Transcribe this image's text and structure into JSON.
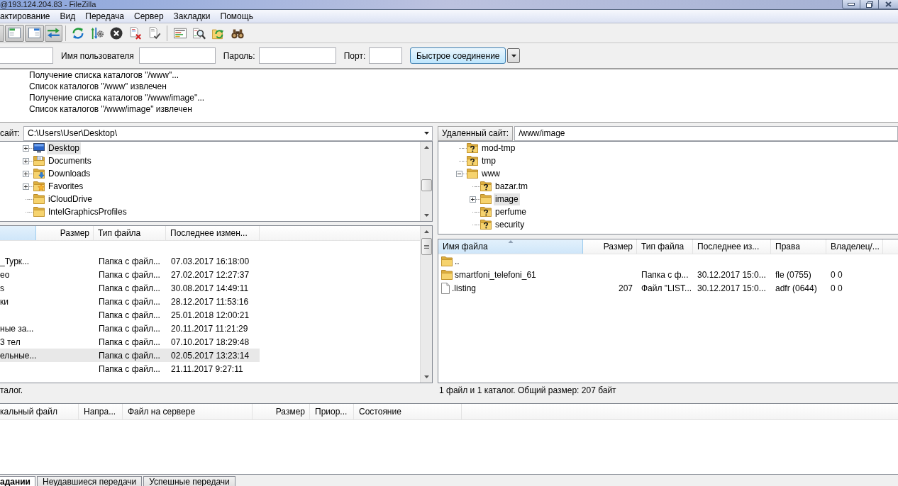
{
  "window": {
    "title": "@193.124.204.83 - FileZilla"
  },
  "menu": [
    "актирование",
    "Вид",
    "Передача",
    "Сервер",
    "Закладки",
    "Помощь"
  ],
  "toolbar": {
    "view_toggles": [
      {
        "on": true
      },
      {
        "on": true
      },
      {
        "on": true
      },
      {
        "on": true
      }
    ]
  },
  "quickconnect": {
    "field_labels": [
      "Имя пользователя",
      "Пароль:",
      "Порт:"
    ],
    "button": "Быстрое соединение"
  },
  "message_log": [
    "Получение списка каталогов \"/www\"...",
    "Список каталогов \"/www\" извлечен",
    "Получение списка каталогов \"/www/image\"...",
    "Список каталогов \"/www/image\" извлечен"
  ],
  "local": {
    "site_label": "сайт:",
    "path": "C:\\Users\\User\\Desktop\\",
    "tree": [
      {
        "label": "Desktop",
        "kind": "desktop",
        "has_children": true,
        "expanded": false,
        "selected": true
      },
      {
        "label": "Documents",
        "kind": "documents",
        "has_children": true,
        "expanded": false,
        "selected": false
      },
      {
        "label": "Downloads",
        "kind": "downloads",
        "has_children": true,
        "expanded": false,
        "selected": false
      },
      {
        "label": "Favorites",
        "kind": "favorites",
        "has_children": true,
        "expanded": false,
        "selected": false
      },
      {
        "label": "iCloudDrive",
        "kind": "folder",
        "has_children": false,
        "selected": false
      },
      {
        "label": "IntelGraphicsProfiles",
        "kind": "folder",
        "has_children": false,
        "selected": false
      }
    ],
    "columns": [
      {
        "sorted": true
      },
      {
        "label": "Размер",
        "sorted": false
      },
      {
        "label": "Тип файла",
        "sorted": false
      },
      {
        "label": "Последнее измен...",
        "sorted": false
      }
    ],
    "rows": [
      {
        "selected": false
      },
      {
        "name": "_Турк...",
        "type": "Папка с файл...",
        "modified": "07.03.2017 16:18:00",
        "selected": false
      },
      {
        "name": "ео",
        "type": "Папка с файл...",
        "modified": "27.02.2017 12:27:37",
        "selected": false
      },
      {
        "name": "s",
        "type": "Папка с файл...",
        "modified": "30.08.2017 14:49:11",
        "selected": false
      },
      {
        "name": "ки",
        "type": "Папка с файл...",
        "modified": "28.12.2017 11:53:16",
        "selected": false
      },
      {
        "type": "Папка с файл...",
        "modified": "25.01.2018 12:00:21",
        "selected": false
      },
      {
        "name": "ные за...",
        "type": "Папка с файл...",
        "modified": "20.11.2017 11:21:29",
        "selected": false
      },
      {
        "name": "3 тел",
        "type": "Папка с файл...",
        "modified": "07.10.2017 18:29:48",
        "selected": false
      },
      {
        "name": "ельные...",
        "type": "Папка с файл...",
        "modified": "02.05.2017 13:23:14",
        "selected": true
      },
      {
        "type": "Папка с файл...",
        "modified": "21.11.2017 9:27:11",
        "selected": false
      }
    ],
    "status": "талог."
  },
  "remote": {
    "site_label": "Удаленный сайт:",
    "path": "/www/image",
    "tree": [
      {
        "label": "mod-tmp",
        "kind": "unknown",
        "has_children": false,
        "selected": false
      },
      {
        "label": "tmp",
        "kind": "unknown",
        "has_children": false,
        "selected": false
      },
      {
        "label": "www",
        "kind": "folder",
        "has_children": true,
        "expanded": true,
        "selected": false,
        "children": [
          {
            "label": "bazar.tm",
            "kind": "unknown",
            "has_children": false,
            "selected": false
          },
          {
            "label": "image",
            "kind": "folder",
            "has_children": true,
            "expanded": false,
            "selected": true
          },
          {
            "label": "perfume",
            "kind": "unknown",
            "has_children": false,
            "selected": false
          },
          {
            "label": "security",
            "kind": "unknown",
            "has_children": false,
            "selected": false
          }
        ]
      }
    ],
    "columns": [
      {
        "label": "Имя файла",
        "sorted": true
      },
      {
        "label": "Размер",
        "sorted": false
      },
      {
        "label": "Тип файла",
        "sorted": false
      },
      {
        "label": "Последнее из...",
        "sorted": false
      },
      {
        "label": "Права",
        "sorted": false
      },
      {
        "label": "Владелец/...",
        "sorted": false
      }
    ],
    "rows": [
      {
        "kind": "folder",
        "name": ".."
      },
      {
        "kind": "folder",
        "name": "smartfoni_telefoni_61",
        "type": "Папка с ф...",
        "modified": "30.12.2017 15:0...",
        "permissions": "fle (0755)",
        "owner": "0 0"
      },
      {
        "kind": "file",
        "name": ".listing",
        "size": "207",
        "type": "Файл \"LIST...",
        "modified": "30.12.2017 15:0...",
        "permissions": "adfr (0644)",
        "owner": "0 0"
      }
    ],
    "status": "1 файл и 1 каталог. Общий размер: 207 байт"
  },
  "queue": {
    "columns": [
      "кальный файл",
      "Напра...",
      "Файл на сервере",
      "Размер",
      "Приор...",
      "Состояние"
    ],
    "tabs": [
      {
        "label": "адании",
        "selected": true
      },
      {
        "label": "Неудавшиеся передачи",
        "selected": false
      },
      {
        "label": "Успешные передачи",
        "selected": false
      }
    ]
  }
}
